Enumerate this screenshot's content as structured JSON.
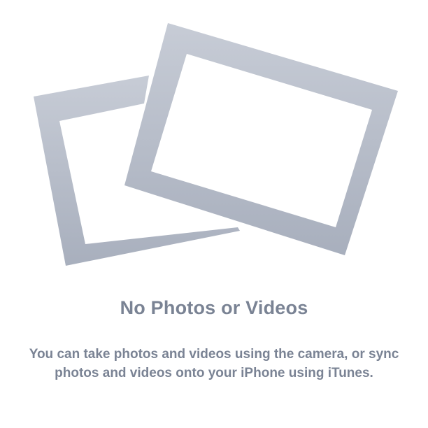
{
  "empty_state": {
    "title": "No Photos or Videos",
    "message": "You can take photos and videos using the camera, or sync photos and videos onto your iPhone using iTunes.",
    "icon": "photo-frames-icon"
  },
  "colors": {
    "frame_light": "#c3c8d3",
    "frame_dark": "#a9b0be",
    "text": "#7a8394",
    "background": "#ffffff"
  }
}
